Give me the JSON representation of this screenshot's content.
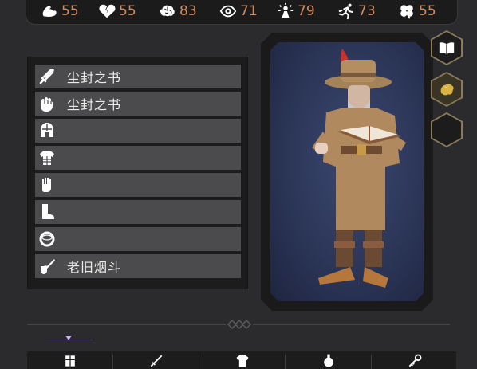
{
  "stats": [
    {
      "icon": "strength-arm-icon",
      "value": "55"
    },
    {
      "icon": "broken-heart-icon",
      "value": "55"
    },
    {
      "icon": "brain-icon",
      "value": "83"
    },
    {
      "icon": "eye-icon",
      "value": "71"
    },
    {
      "icon": "sparkle-figure-icon",
      "value": "79"
    },
    {
      "icon": "running-figure-icon",
      "value": "73"
    },
    {
      "icon": "clover-icon",
      "value": "55"
    }
  ],
  "equipment": [
    {
      "slot": "weapon",
      "icon": "sword-icon",
      "item": "尘封之书"
    },
    {
      "slot": "offhand",
      "icon": "fist-icon",
      "item": "尘封之书"
    },
    {
      "slot": "head",
      "icon": "helmet-icon",
      "item": ""
    },
    {
      "slot": "body",
      "icon": "armor-icon",
      "item": ""
    },
    {
      "slot": "hands",
      "icon": "gauntlet-icon",
      "item": ""
    },
    {
      "slot": "feet",
      "icon": "boot-icon",
      "item": ""
    },
    {
      "slot": "ring",
      "icon": "ring-icon",
      "item": ""
    },
    {
      "slot": "trinket",
      "icon": "pipe-icon",
      "item": "老旧烟斗"
    }
  ],
  "side_buttons": [
    "book-icon",
    "gold-nugget-icon",
    "empty-slot"
  ],
  "bottom_tabs": [
    "armor-tab-icon",
    "sword-tab-icon",
    "shirt-tab-icon",
    "potion-tab-icon",
    "key-tab-icon"
  ],
  "colors": {
    "stat_value": "#d58a5c",
    "slot_bg": "#4b4b4d",
    "frame_gold": "#8a7a5a",
    "portrait_bg": "#2c3658"
  }
}
